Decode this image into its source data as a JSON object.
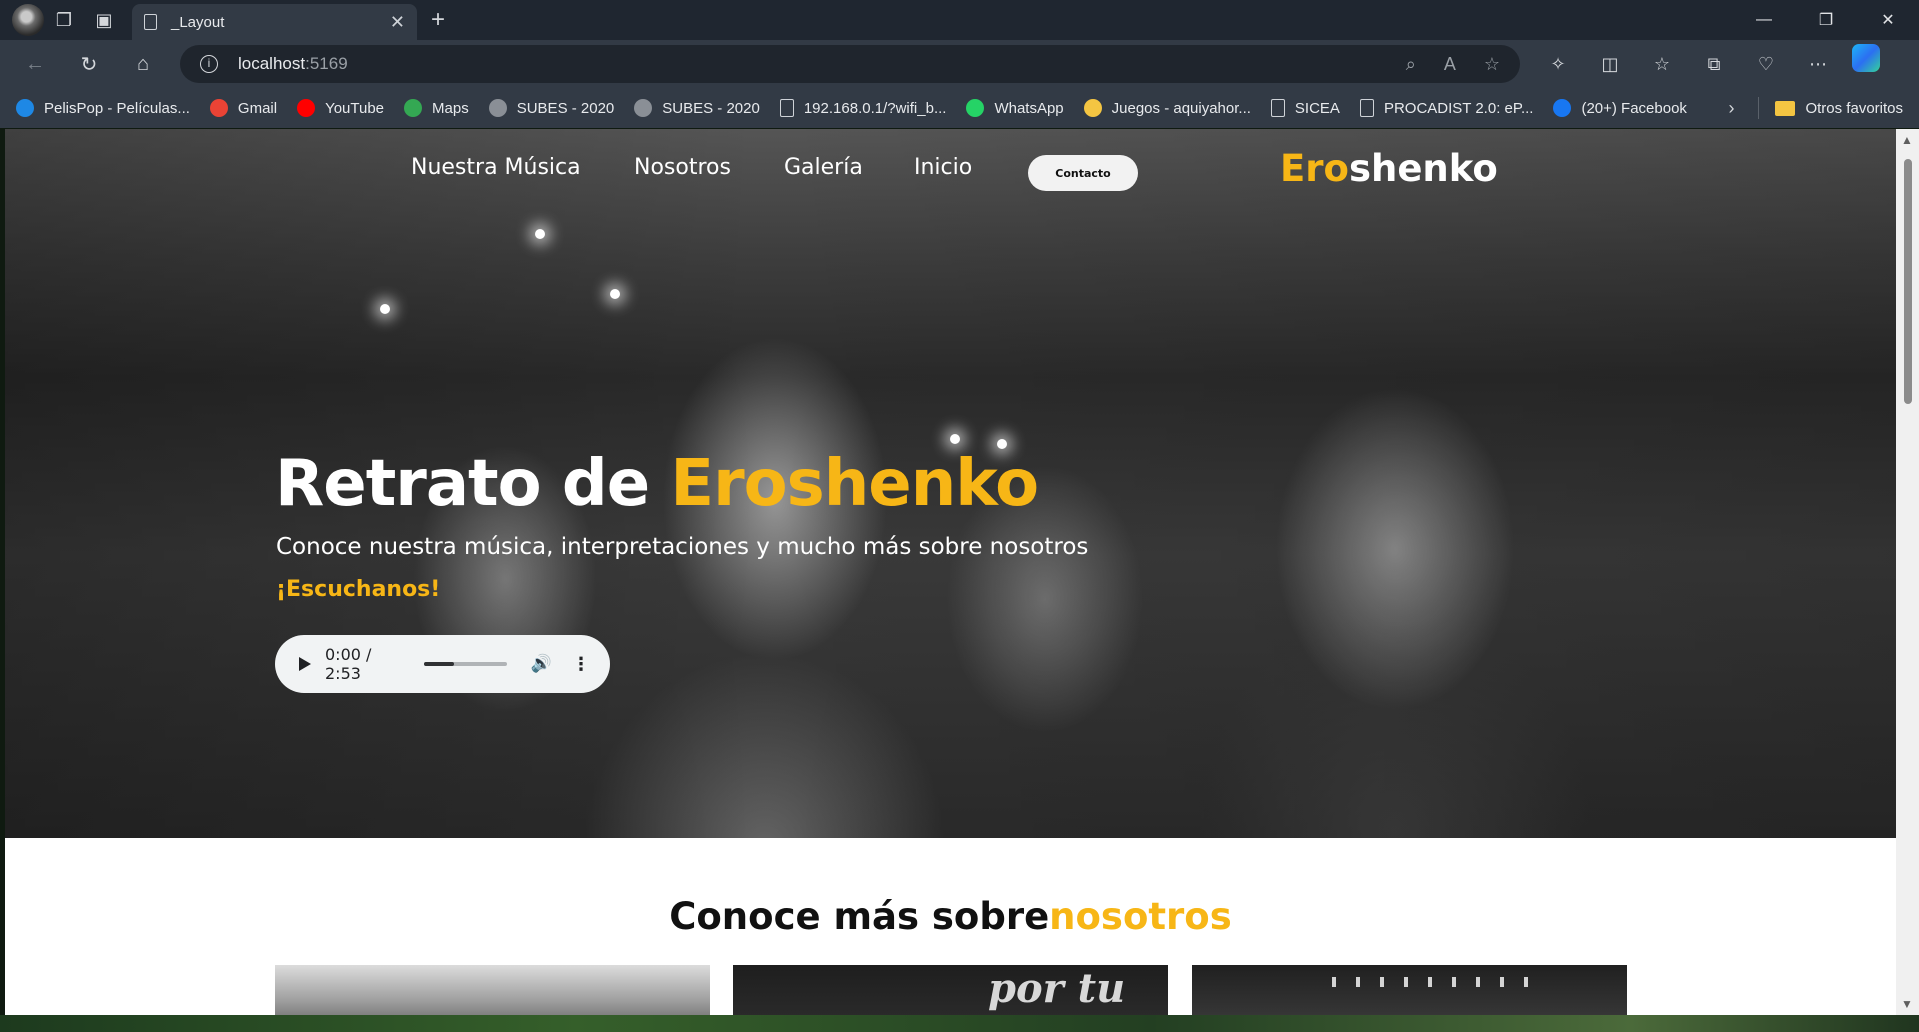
{
  "browser": {
    "tab_title": "_Layout",
    "url_host": "localhost",
    "url_port": ":5169",
    "bookmarks": [
      {
        "label": "PelisPop - Películas...",
        "color": "#1e88e5"
      },
      {
        "label": "Gmail",
        "color": "#ea4335"
      },
      {
        "label": "YouTube",
        "color": "#ff0000"
      },
      {
        "label": "Maps",
        "color": "#34a853"
      },
      {
        "label": "SUBES - 2020",
        "color": "#8a8f96"
      },
      {
        "label": "SUBES - 2020",
        "color": "#8a8f96"
      },
      {
        "label": "192.168.0.1/?wifi_b...",
        "color": "doc"
      },
      {
        "label": "WhatsApp",
        "color": "#25d366"
      },
      {
        "label": "Juegos - aquiyahor...",
        "color": "#f4c542"
      },
      {
        "label": "SICEA",
        "color": "doc"
      },
      {
        "label": "PROCADIST 2.0: eP...",
        "color": "doc"
      },
      {
        "label": "(20+) Facebook",
        "color": "#1877f2"
      }
    ],
    "other_favorites": "Otros favoritos"
  },
  "site": {
    "nav": [
      "Nuestra Música",
      "Nosotros",
      "Galería",
      "Inicio"
    ],
    "contact_label": "Contacto",
    "brand_accent": "Ero",
    "brand_rest": "shenko"
  },
  "hero": {
    "title_main": "Retrato de ",
    "title_accent": "Eroshenko",
    "subtitle": "Conoce nuestra música, interpretaciones y mucho más sobre nosotros",
    "cta": "¡Escuchanos!"
  },
  "player": {
    "time": "0:00 / 2:53",
    "progress": 0.36
  },
  "about": {
    "title_main": "Conoce más sobre",
    "title_accent": "nosotros",
    "card2_text": "por tu"
  },
  "colors": {
    "accent": "#f7b616",
    "chrome_dark": "#1f2630",
    "chrome": "#323a45"
  }
}
